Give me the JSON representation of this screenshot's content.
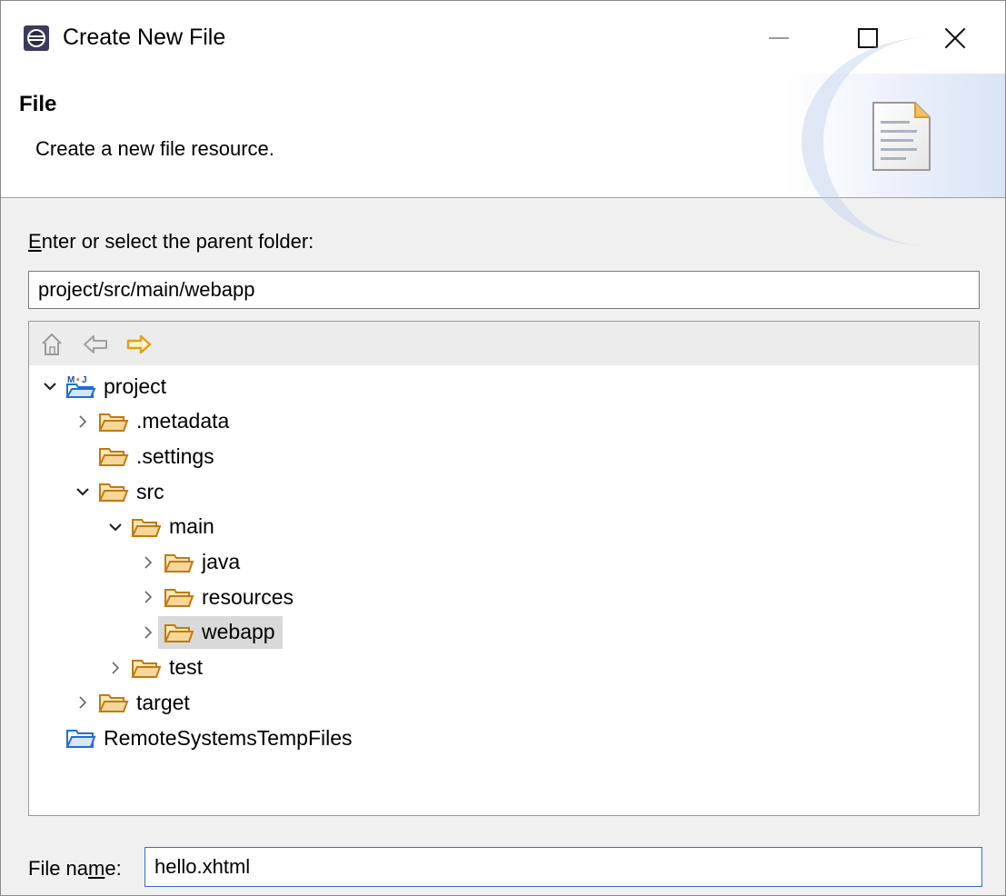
{
  "window": {
    "title": "Create New File",
    "controls": {
      "minimize": "minimize-icon",
      "maximize": "maximize-icon",
      "close": "close-icon"
    }
  },
  "header": {
    "title": "File",
    "description": "Create a new file resource."
  },
  "parent_folder": {
    "label_accel": "E",
    "label_rest": "nter or select the parent folder:",
    "value": "project/src/main/webapp"
  },
  "tree": {
    "toolbar": [
      "home-icon",
      "back-arrow-icon",
      "forward-arrow-icon"
    ],
    "items": [
      {
        "label": "project",
        "depth": 0,
        "twisty": "expanded",
        "icon": "maven-project-icon"
      },
      {
        "label": ".metadata",
        "depth": 1,
        "twisty": "collapsed",
        "icon": "folder-icon"
      },
      {
        "label": ".settings",
        "depth": 1,
        "twisty": "none",
        "icon": "folder-icon"
      },
      {
        "label": "src",
        "depth": 1,
        "twisty": "expanded",
        "icon": "folder-icon"
      },
      {
        "label": "main",
        "depth": 2,
        "twisty": "expanded",
        "icon": "folder-icon"
      },
      {
        "label": "java",
        "depth": 3,
        "twisty": "collapsed",
        "icon": "folder-icon"
      },
      {
        "label": "resources",
        "depth": 3,
        "twisty": "collapsed",
        "icon": "folder-icon"
      },
      {
        "label": "webapp",
        "depth": 3,
        "twisty": "collapsed",
        "icon": "folder-icon",
        "selected": true
      },
      {
        "label": "test",
        "depth": 2,
        "twisty": "collapsed",
        "icon": "folder-icon"
      },
      {
        "label": "target",
        "depth": 1,
        "twisty": "collapsed",
        "icon": "folder-icon"
      },
      {
        "label": "RemoteSystemsTempFiles",
        "depth": 0,
        "twisty": "none",
        "icon": "project-folder-icon"
      }
    ]
  },
  "file_name": {
    "label_pre": "File na",
    "label_accel": "m",
    "label_post": "e:",
    "value": "hello.xhtml"
  },
  "colors": {
    "folder_fill": "#f6d79a",
    "folder_stroke": "#c07a12",
    "selection": "#d9d9d9",
    "focus_border": "#2f6fd0",
    "forward_arrow": "#e0a020"
  }
}
